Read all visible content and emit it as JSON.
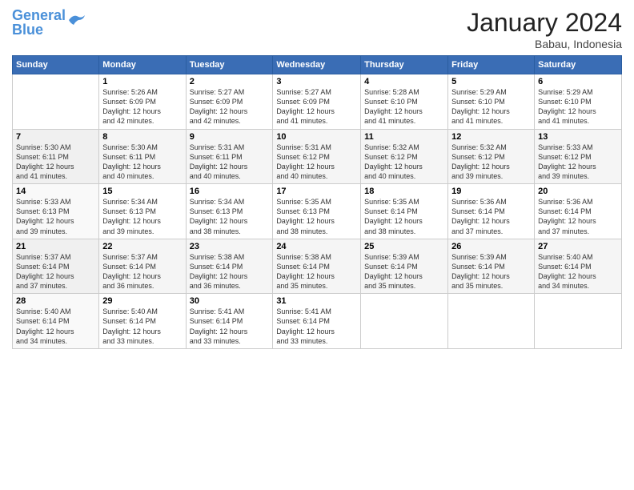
{
  "logo": {
    "line1": "General",
    "line2": "Blue"
  },
  "title": "January 2024",
  "subtitle": "Babau, Indonesia",
  "header_days": [
    "Sunday",
    "Monday",
    "Tuesday",
    "Wednesday",
    "Thursday",
    "Friday",
    "Saturday"
  ],
  "weeks": [
    [
      {
        "num": "",
        "info": ""
      },
      {
        "num": "1",
        "info": "Sunrise: 5:26 AM\nSunset: 6:09 PM\nDaylight: 12 hours\nand 42 minutes."
      },
      {
        "num": "2",
        "info": "Sunrise: 5:27 AM\nSunset: 6:09 PM\nDaylight: 12 hours\nand 42 minutes."
      },
      {
        "num": "3",
        "info": "Sunrise: 5:27 AM\nSunset: 6:09 PM\nDaylight: 12 hours\nand 41 minutes."
      },
      {
        "num": "4",
        "info": "Sunrise: 5:28 AM\nSunset: 6:10 PM\nDaylight: 12 hours\nand 41 minutes."
      },
      {
        "num": "5",
        "info": "Sunrise: 5:29 AM\nSunset: 6:10 PM\nDaylight: 12 hours\nand 41 minutes."
      },
      {
        "num": "6",
        "info": "Sunrise: 5:29 AM\nSunset: 6:10 PM\nDaylight: 12 hours\nand 41 minutes."
      }
    ],
    [
      {
        "num": "7",
        "info": "Sunrise: 5:30 AM\nSunset: 6:11 PM\nDaylight: 12 hours\nand 41 minutes."
      },
      {
        "num": "8",
        "info": "Sunrise: 5:30 AM\nSunset: 6:11 PM\nDaylight: 12 hours\nand 40 minutes."
      },
      {
        "num": "9",
        "info": "Sunrise: 5:31 AM\nSunset: 6:11 PM\nDaylight: 12 hours\nand 40 minutes."
      },
      {
        "num": "10",
        "info": "Sunrise: 5:31 AM\nSunset: 6:12 PM\nDaylight: 12 hours\nand 40 minutes."
      },
      {
        "num": "11",
        "info": "Sunrise: 5:32 AM\nSunset: 6:12 PM\nDaylight: 12 hours\nand 40 minutes."
      },
      {
        "num": "12",
        "info": "Sunrise: 5:32 AM\nSunset: 6:12 PM\nDaylight: 12 hours\nand 39 minutes."
      },
      {
        "num": "13",
        "info": "Sunrise: 5:33 AM\nSunset: 6:12 PM\nDaylight: 12 hours\nand 39 minutes."
      }
    ],
    [
      {
        "num": "14",
        "info": "Sunrise: 5:33 AM\nSunset: 6:13 PM\nDaylight: 12 hours\nand 39 minutes."
      },
      {
        "num": "15",
        "info": "Sunrise: 5:34 AM\nSunset: 6:13 PM\nDaylight: 12 hours\nand 39 minutes."
      },
      {
        "num": "16",
        "info": "Sunrise: 5:34 AM\nSunset: 6:13 PM\nDaylight: 12 hours\nand 38 minutes."
      },
      {
        "num": "17",
        "info": "Sunrise: 5:35 AM\nSunset: 6:13 PM\nDaylight: 12 hours\nand 38 minutes."
      },
      {
        "num": "18",
        "info": "Sunrise: 5:35 AM\nSunset: 6:14 PM\nDaylight: 12 hours\nand 38 minutes."
      },
      {
        "num": "19",
        "info": "Sunrise: 5:36 AM\nSunset: 6:14 PM\nDaylight: 12 hours\nand 37 minutes."
      },
      {
        "num": "20",
        "info": "Sunrise: 5:36 AM\nSunset: 6:14 PM\nDaylight: 12 hours\nand 37 minutes."
      }
    ],
    [
      {
        "num": "21",
        "info": "Sunrise: 5:37 AM\nSunset: 6:14 PM\nDaylight: 12 hours\nand 37 minutes."
      },
      {
        "num": "22",
        "info": "Sunrise: 5:37 AM\nSunset: 6:14 PM\nDaylight: 12 hours\nand 36 minutes."
      },
      {
        "num": "23",
        "info": "Sunrise: 5:38 AM\nSunset: 6:14 PM\nDaylight: 12 hours\nand 36 minutes."
      },
      {
        "num": "24",
        "info": "Sunrise: 5:38 AM\nSunset: 6:14 PM\nDaylight: 12 hours\nand 35 minutes."
      },
      {
        "num": "25",
        "info": "Sunrise: 5:39 AM\nSunset: 6:14 PM\nDaylight: 12 hours\nand 35 minutes."
      },
      {
        "num": "26",
        "info": "Sunrise: 5:39 AM\nSunset: 6:14 PM\nDaylight: 12 hours\nand 35 minutes."
      },
      {
        "num": "27",
        "info": "Sunrise: 5:40 AM\nSunset: 6:14 PM\nDaylight: 12 hours\nand 34 minutes."
      }
    ],
    [
      {
        "num": "28",
        "info": "Sunrise: 5:40 AM\nSunset: 6:14 PM\nDaylight: 12 hours\nand 34 minutes."
      },
      {
        "num": "29",
        "info": "Sunrise: 5:40 AM\nSunset: 6:14 PM\nDaylight: 12 hours\nand 33 minutes."
      },
      {
        "num": "30",
        "info": "Sunrise: 5:41 AM\nSunset: 6:14 PM\nDaylight: 12 hours\nand 33 minutes."
      },
      {
        "num": "31",
        "info": "Sunrise: 5:41 AM\nSunset: 6:14 PM\nDaylight: 12 hours\nand 33 minutes."
      },
      {
        "num": "",
        "info": ""
      },
      {
        "num": "",
        "info": ""
      },
      {
        "num": "",
        "info": ""
      }
    ]
  ]
}
